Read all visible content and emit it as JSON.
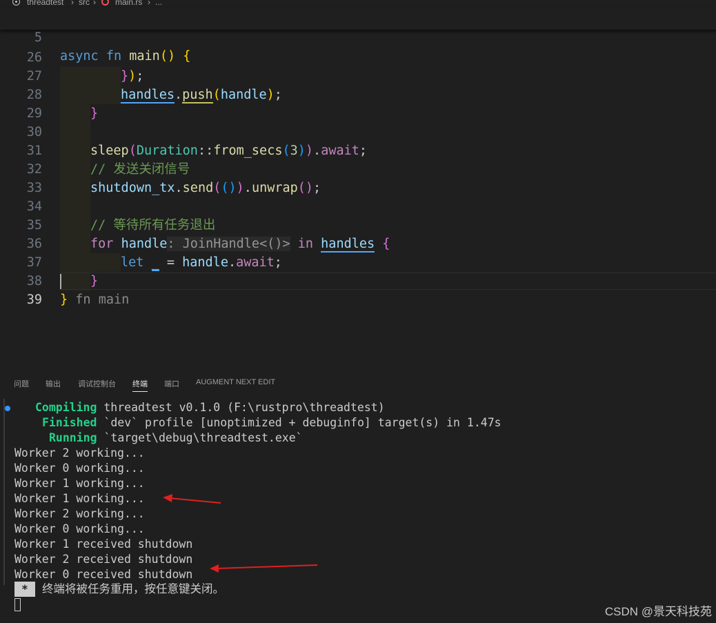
{
  "breadcrumb": {
    "project": "threadtest",
    "folder": "src",
    "file": "main.rs",
    "more": "..."
  },
  "sticky": {
    "line_number": "5",
    "code": "async fn main() {"
  },
  "editor": {
    "lines": [
      {
        "n": "26",
        "code": "});"
      },
      {
        "n": "27",
        "code": "handles.push(handle);"
      },
      {
        "n": "28",
        "code": "}"
      },
      {
        "n": "29",
        "code": ""
      },
      {
        "n": "30",
        "code": "sleep(Duration::from_secs(3)).await;"
      },
      {
        "n": "31",
        "code": "// 发送关闭信号"
      },
      {
        "n": "32",
        "code": "shutdown_tx.send(()).unwrap();"
      },
      {
        "n": "33",
        "code": ""
      },
      {
        "n": "34",
        "code": "// 等待所有任务退出"
      },
      {
        "n": "35",
        "code": "for handle: JoinHandle<()> in handles {"
      },
      {
        "n": "36",
        "code": "let _ = handle.await;"
      },
      {
        "n": "37",
        "code": "}"
      },
      {
        "n": "38",
        "code": "} fn main"
      },
      {
        "n": "39",
        "code": ""
      }
    ]
  },
  "panel": {
    "tabs": [
      "问题",
      "输出",
      "调试控制台",
      "终端",
      "端口",
      "AUGMENT NEXT EDIT"
    ],
    "active_tab": "终端"
  },
  "terminal": {
    "compiling_label": "Compiling",
    "compiling_text": " threadtest v0.1.0 (F:\\rustpro\\threadtest)",
    "finished_label": "Finished",
    "finished_text": " `dev` profile [unoptimized + debuginfo] target(s) in 1.47s",
    "running_label": "Running",
    "running_text": " `target\\debug\\threadtest.exe`",
    "output": [
      "Worker 2 working...",
      "Worker 0 working...",
      "Worker 1 working...",
      "Worker 1 working...",
      "Worker 2 working...",
      "Worker 0 working...",
      "Worker 1 received shutdown",
      "Worker 2 received shutdown",
      "Worker 0 received shutdown"
    ],
    "reuse_marker": "*",
    "reuse_message": "终端将被任务重用，按任意键关闭。"
  },
  "watermark": "CSDN @景天科技苑",
  "colors": {
    "background": "#1f1f1f",
    "annotation_arrow": "#e02020",
    "success_green": "#23d18b"
  }
}
